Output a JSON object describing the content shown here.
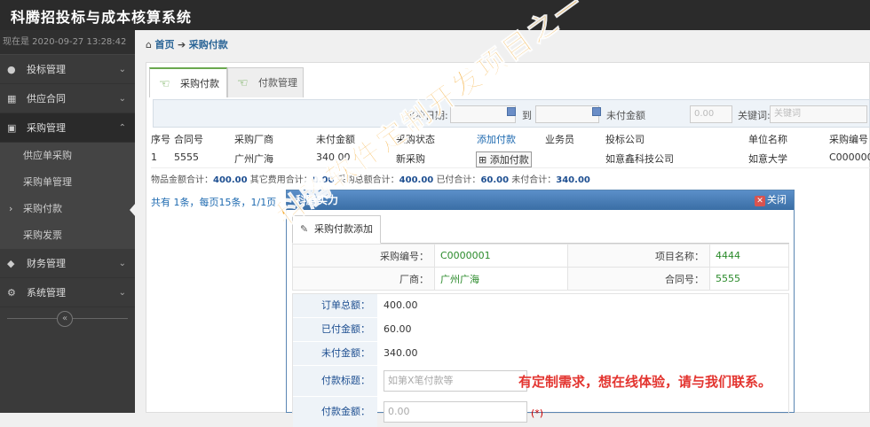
{
  "app": {
    "title": "科腾招投标与成本核算系统"
  },
  "clock": "现在是 2020-09-27 13:28:42",
  "sidebar": {
    "items": [
      {
        "label": "投标管理",
        "icon": "user-icon"
      },
      {
        "label": "供应合同",
        "icon": "grid-icon"
      },
      {
        "label": "采购管理",
        "icon": "briefcase-icon"
      },
      {
        "label": "财务管理",
        "icon": "diamond-icon"
      },
      {
        "label": "系统管理",
        "icon": "gear-icon"
      }
    ],
    "sub_items": [
      "供应单采购",
      "采购单管理",
      "采购付款",
      "采购发票"
    ],
    "collapse": "«"
  },
  "breadcrumb": {
    "home": "首页",
    "arrow": "➔",
    "current": "采购付款"
  },
  "tabs": [
    "采购付款",
    "付款管理"
  ],
  "search": {
    "date_label": "采购日期:",
    "to_label": "到",
    "unpaid_label": "未付金额",
    "unpaid_value": "0.00",
    "keyword_label": "关键词:",
    "keyword_placeholder": "关键词"
  },
  "grid": {
    "headers": [
      "序号",
      "合同号",
      "采购厂商",
      "未付金额",
      "采购状态",
      "添加付款",
      "业务员",
      "投标公司",
      "单位名称",
      "采购编号"
    ],
    "rows": [
      [
        "1",
        "5555",
        "广州广海",
        "340.00",
        "新采购",
        "添加付款",
        "",
        "如意鑫科技公司",
        "如意大学",
        "C000000"
      ]
    ]
  },
  "summary": {
    "goods_label": "物品金额合计：",
    "goods": "400.00",
    "other_label": "其它费用合计：",
    "other": "0.00",
    "total_label": "采购总额合计：",
    "total": "400.00",
    "paid_label": "已付合计：",
    "paid": "60.00",
    "unpaid_label": "未付合计：",
    "unpaid": "340.00"
  },
  "pager": "共有 1条，每页15条，1/1页",
  "dialog": {
    "title": "科腾实力",
    "close": "关闭",
    "tab": "采购付款添加",
    "info": {
      "purchase_no_label": "采购编号：",
      "purchase_no": "C0000001",
      "project_label": "项目名称：",
      "project": "4444",
      "vendor_label": "厂商：",
      "vendor": "广州广海",
      "contract_label": "合同号：",
      "contract": "5555"
    },
    "form": {
      "order_total_label": "订单总额：",
      "order_total": "400.00",
      "paid_label": "已付金额：",
      "paid": "60.00",
      "unpaid_label": "未付金额：",
      "unpaid": "340.00",
      "pay_title_label": "付款标题：",
      "pay_title_placeholder": "如第X笔付款等",
      "pay_amount_label": "付款金额：",
      "pay_amount": "0.00",
      "required": "(*)"
    }
  },
  "watermark": "科腾软件定制开发项目之一",
  "promo": "有定制需求，想在线体验，请与我们联系。"
}
